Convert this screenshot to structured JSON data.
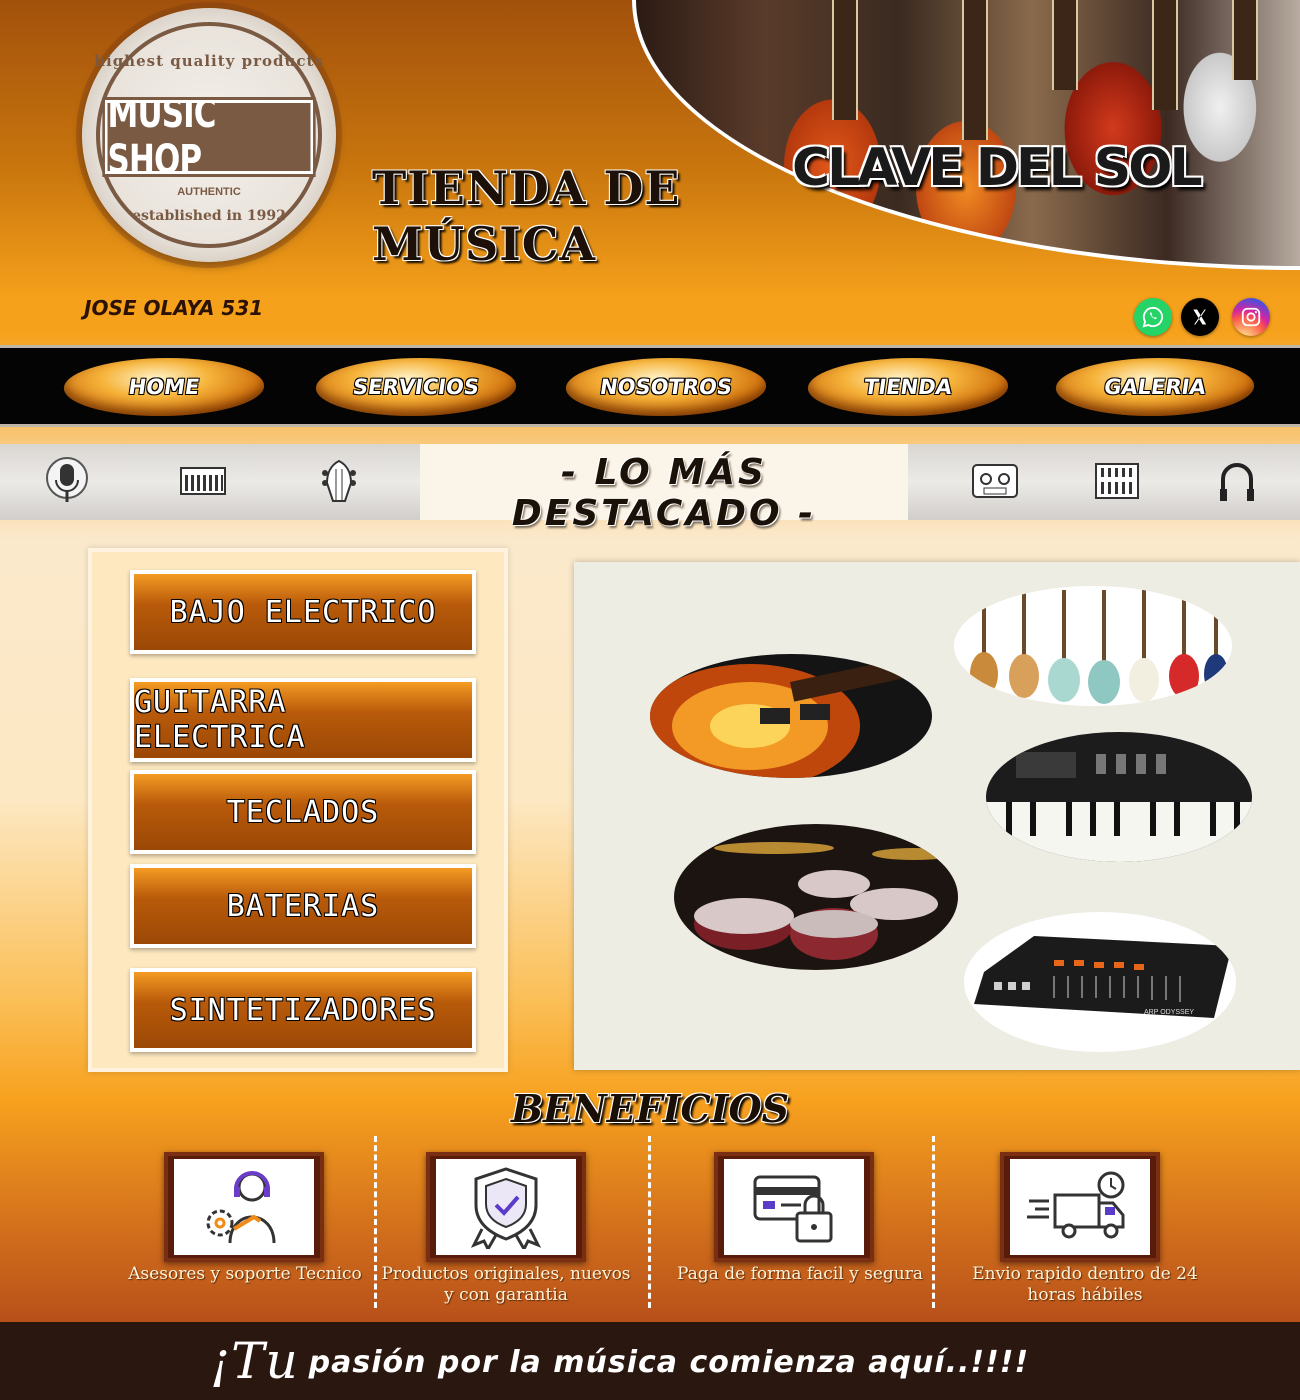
{
  "header": {
    "logo": {
      "arc_text": "highest quality products",
      "main_text": "MUSIC SHOP",
      "authentic": "AUTHENTIC",
      "established": "established in 1992"
    },
    "store_title": "TIENDA DE MÚSICA",
    "brand": "CLAVE DEL SOL",
    "address": "JOSE OLAYA 531",
    "social": [
      {
        "name": "whatsapp",
        "icon": "whatsapp-icon",
        "color": "#25d366"
      },
      {
        "name": "x",
        "icon": "x-icon",
        "color": "#000000"
      },
      {
        "name": "instagram",
        "icon": "instagram-icon",
        "color": "#e1306c"
      }
    ]
  },
  "nav": {
    "items": [
      {
        "label": "HOME"
      },
      {
        "label": "SERVICIOS"
      },
      {
        "label": "NOSOTROS"
      },
      {
        "label": "TIENDA"
      },
      {
        "label": "GALERIA"
      }
    ]
  },
  "highlights": {
    "title": "- LO MÁS DESTACADO -",
    "left_icons": [
      "microphone-icon",
      "keyboard-icon",
      "guitar-headstock-icon"
    ],
    "right_icons": [
      "cassette-icon",
      "synthesizer-icon",
      "headphones-icon"
    ]
  },
  "categories": [
    {
      "label": "BAJO ELECTRICO"
    },
    {
      "label": "GUITARRA ELECTRICA"
    },
    {
      "label": "TECLADOS"
    },
    {
      "label": "BATERIAS"
    },
    {
      "label": "SINTETIZADORES"
    }
  ],
  "gallery": {
    "images": [
      "bass-guitars-image",
      "electric-guitar-image",
      "keyboard-image",
      "drums-image",
      "synthesizer-image"
    ],
    "synth_label": "ARP ODYSSEY"
  },
  "benefits": {
    "title": "BENEFICIOS",
    "items": [
      {
        "icon": "support-agent-icon",
        "text": "Asesores y soporte Tecnico"
      },
      {
        "icon": "guarantee-badge-icon",
        "text": "Productos originales, nuevos y con garantia"
      },
      {
        "icon": "card-payment-lock-icon",
        "text": "Paga de forma facil y segura"
      },
      {
        "icon": "delivery-truck-icon",
        "text": "Envio rapido dentro de 24 horas hábiles"
      }
    ]
  },
  "footer": {
    "slogan_big": "¡Tu",
    "slogan_rest": "pasión  por la música  comienza aquí..!!!!"
  }
}
